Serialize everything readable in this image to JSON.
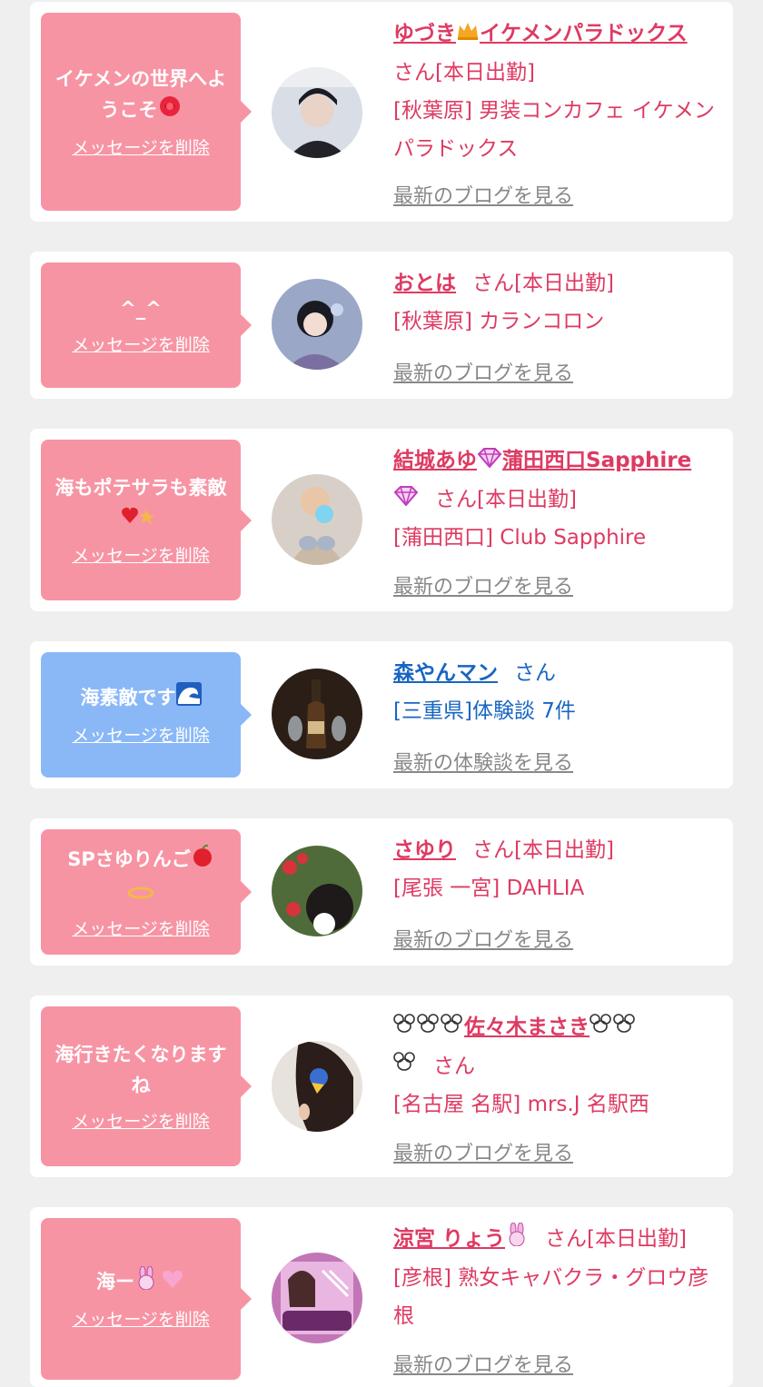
{
  "delete_label": "メッセージを削除",
  "blog_label": "最新のブログを見る",
  "review_label": "最新の体験談を見る",
  "san": "さん",
  "today": "[本日出勤]",
  "colors": {
    "pink_bubble": "#f794a4",
    "blue_bubble": "#8ab8f7",
    "pink_text": "#de3a62",
    "blue_text": "#1866c2",
    "link_gray": "#888888"
  },
  "cards": [
    {
      "message": "イケメンの世界へようこそ",
      "message_icon": "rose-emoji",
      "name": "ゆづき",
      "name_icon": "crown-emoji",
      "name_suffix": "イケメンパラドックス",
      "status": "[本日出勤]",
      "shop": "[秋葉原] 男装コンカフェ イケメンパラドックス",
      "link": "最新のブログを見る"
    },
    {
      "message": "^_^",
      "name": "おとは",
      "status": "[本日出勤]",
      "shop": "[秋葉原] カランコロン",
      "link": "最新のブログを見る"
    },
    {
      "message": "海もポテサラも素敵",
      "message_icon": "heart-sparkle-emoji",
      "name": "結城あゆ",
      "name_icon": "gem-emoji",
      "name_suffix": "蒲田西口Sapphire",
      "name_suffix_icon": "gem-emoji",
      "status": "[本日出勤]",
      "shop": "[蒲田西口] Club Sapphire",
      "link": "最新のブログを見る"
    },
    {
      "message": "海素敵です",
      "message_icon": "wave-emoji",
      "name": "森やんマン",
      "status": "",
      "shop": "[三重県]体験談 7件",
      "link": "最新の体験談を見る"
    },
    {
      "message": "SPさゆりんご",
      "message_icon": "apple-emoji",
      "name": "さゆり",
      "status": "[本日出勤]",
      "shop": "[尾張 一宮] DAHLIA",
      "link": "最新のブログを見る"
    },
    {
      "message": "海行きたくなりますね",
      "name": "佐々木まさき",
      "name_icon": "mouse-emoji",
      "status": "",
      "shop": "[名古屋 名駅] mrs.J 名駅西",
      "link": "最新のブログを見る"
    },
    {
      "message": "海ー",
      "message_icon": "rabbit-heart-emoji",
      "name": "涼宮 りょう",
      "name_icon": "rabbit-emoji",
      "status": "[本日出勤]",
      "shop": "[彦根] 熟女キャバクラ・グロウ彦根",
      "link": "最新のブログを見る"
    }
  ]
}
